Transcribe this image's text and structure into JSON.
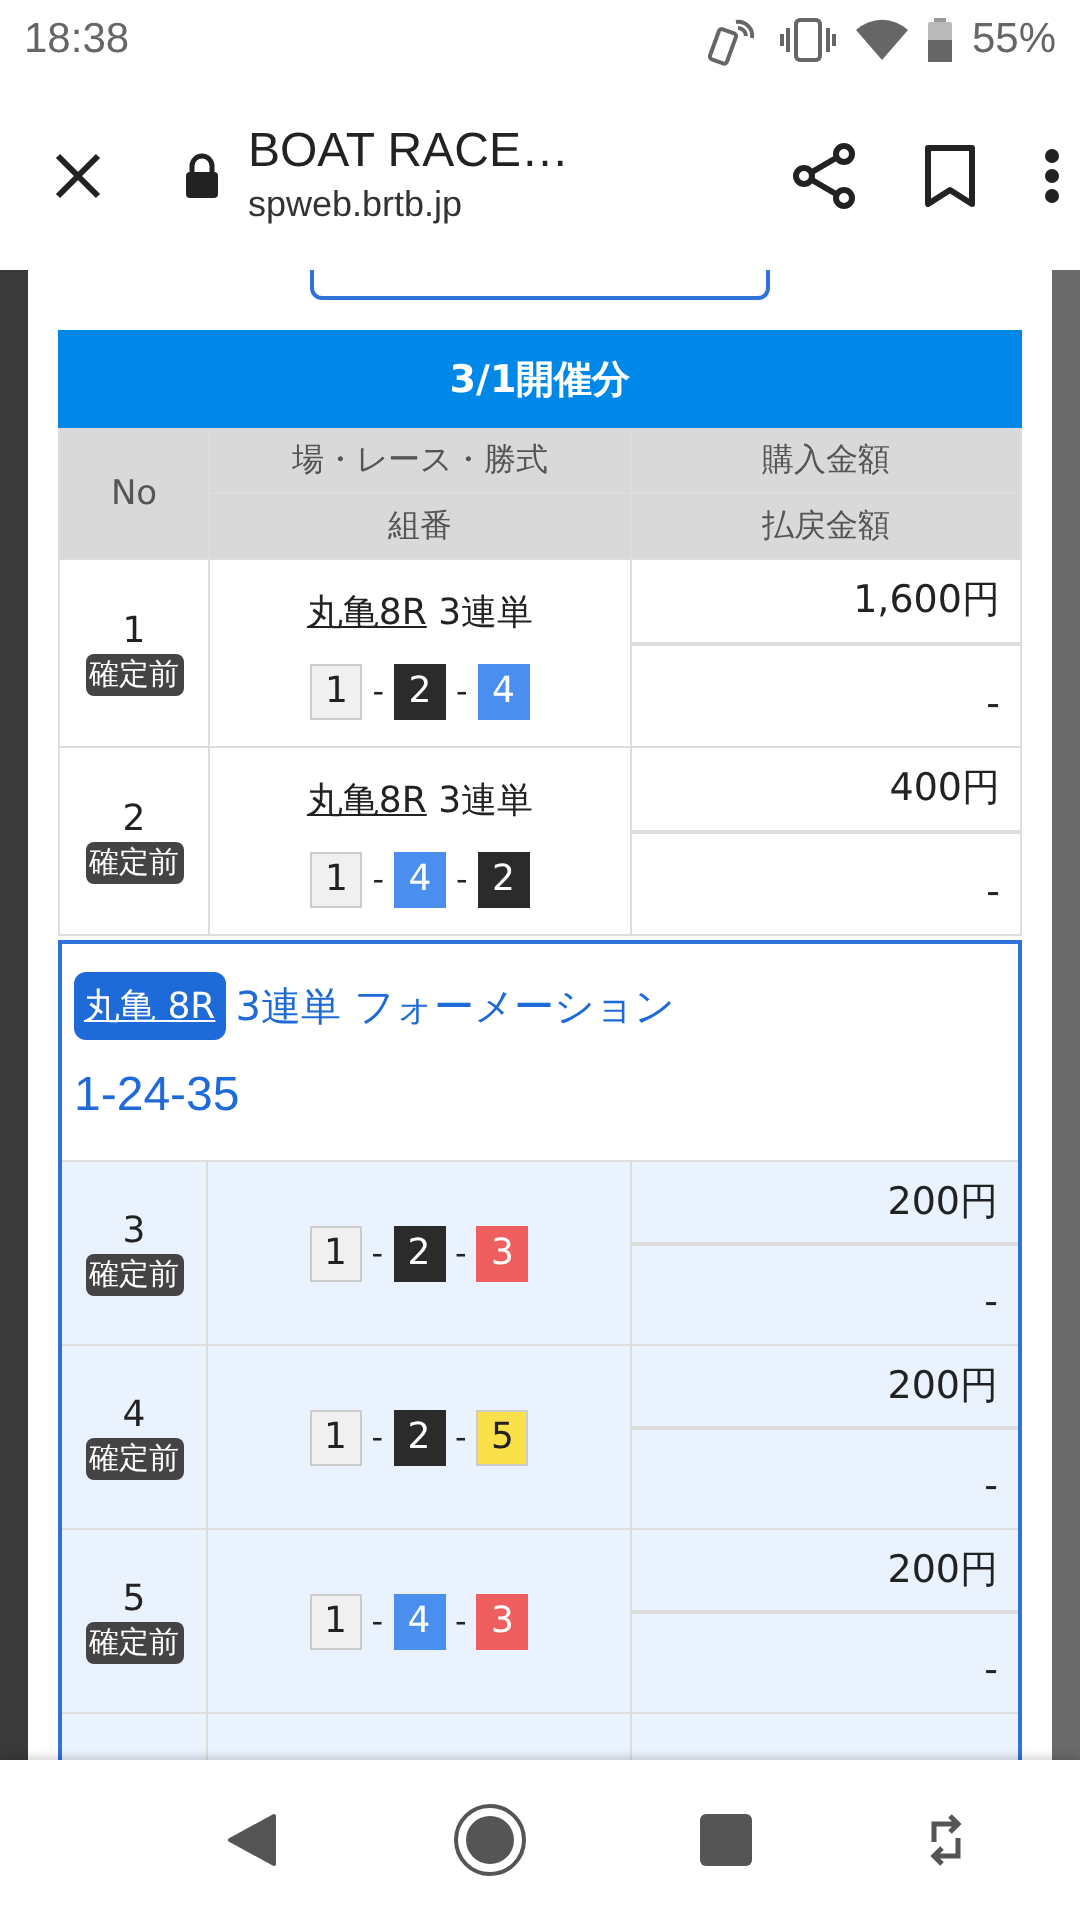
{
  "status_bar": {
    "time": "18:38",
    "battery": "55%"
  },
  "browser": {
    "title": "BOAT RACE…",
    "url": "spweb.brtb.jp"
  },
  "date_header": "3/1開催分",
  "table": {
    "columns": {
      "no": "No",
      "race": "場・レース・勝式",
      "combination": "組番",
      "amount": "購入金額",
      "payout": "払戻金額"
    },
    "rows": [
      {
        "no": "1",
        "status": "確定前",
        "race": "丸亀8R",
        "bet_type": "3連単",
        "dashes": [
          "-",
          "-"
        ],
        "boats": [
          {
            "num": "1",
            "color": "#f0f0f0"
          },
          {
            "num": "2",
            "color": "#2b2b2b"
          },
          {
            "num": "4",
            "color": "#4a8ef0"
          }
        ],
        "amount": "1,600円",
        "payout": "-"
      },
      {
        "no": "2",
        "status": "確定前",
        "race": "丸亀8R",
        "bet_type": "3連単",
        "dashes": [
          "-",
          "-"
        ],
        "boats": [
          {
            "num": "1",
            "color": "#f0f0f0"
          },
          {
            "num": "4",
            "color": "#4a8ef0"
          },
          {
            "num": "2",
            "color": "#2b2b2b"
          }
        ],
        "amount": "400円",
        "payout": "-"
      }
    ]
  },
  "formation": {
    "race_badge": "丸亀 8R",
    "title": "3連単 フォーメーション",
    "combination": "1-24-35",
    "rows": [
      {
        "no": "3",
        "status": "確定前",
        "dashes": [
          "-",
          "-"
        ],
        "boats": [
          {
            "num": "1",
            "color": "#f0f0f0"
          },
          {
            "num": "2",
            "color": "#2b2b2b"
          },
          {
            "num": "3",
            "color": "#ef5f5f"
          }
        ],
        "amount": "200円",
        "payout": "-"
      },
      {
        "no": "4",
        "status": "確定前",
        "dashes": [
          "-",
          "-"
        ],
        "boats": [
          {
            "num": "1",
            "color": "#f0f0f0"
          },
          {
            "num": "2",
            "color": "#2b2b2b"
          },
          {
            "num": "5",
            "color": "#fae14a"
          }
        ],
        "amount": "200円",
        "payout": "-"
      },
      {
        "no": "5",
        "status": "確定前",
        "dashes": [
          "-",
          "-"
        ],
        "boats": [
          {
            "num": "1",
            "color": "#f0f0f0"
          },
          {
            "num": "4",
            "color": "#4a8ef0"
          },
          {
            "num": "3",
            "color": "#ef5f5f"
          }
        ],
        "amount": "200円",
        "payout": "-"
      }
    ]
  }
}
